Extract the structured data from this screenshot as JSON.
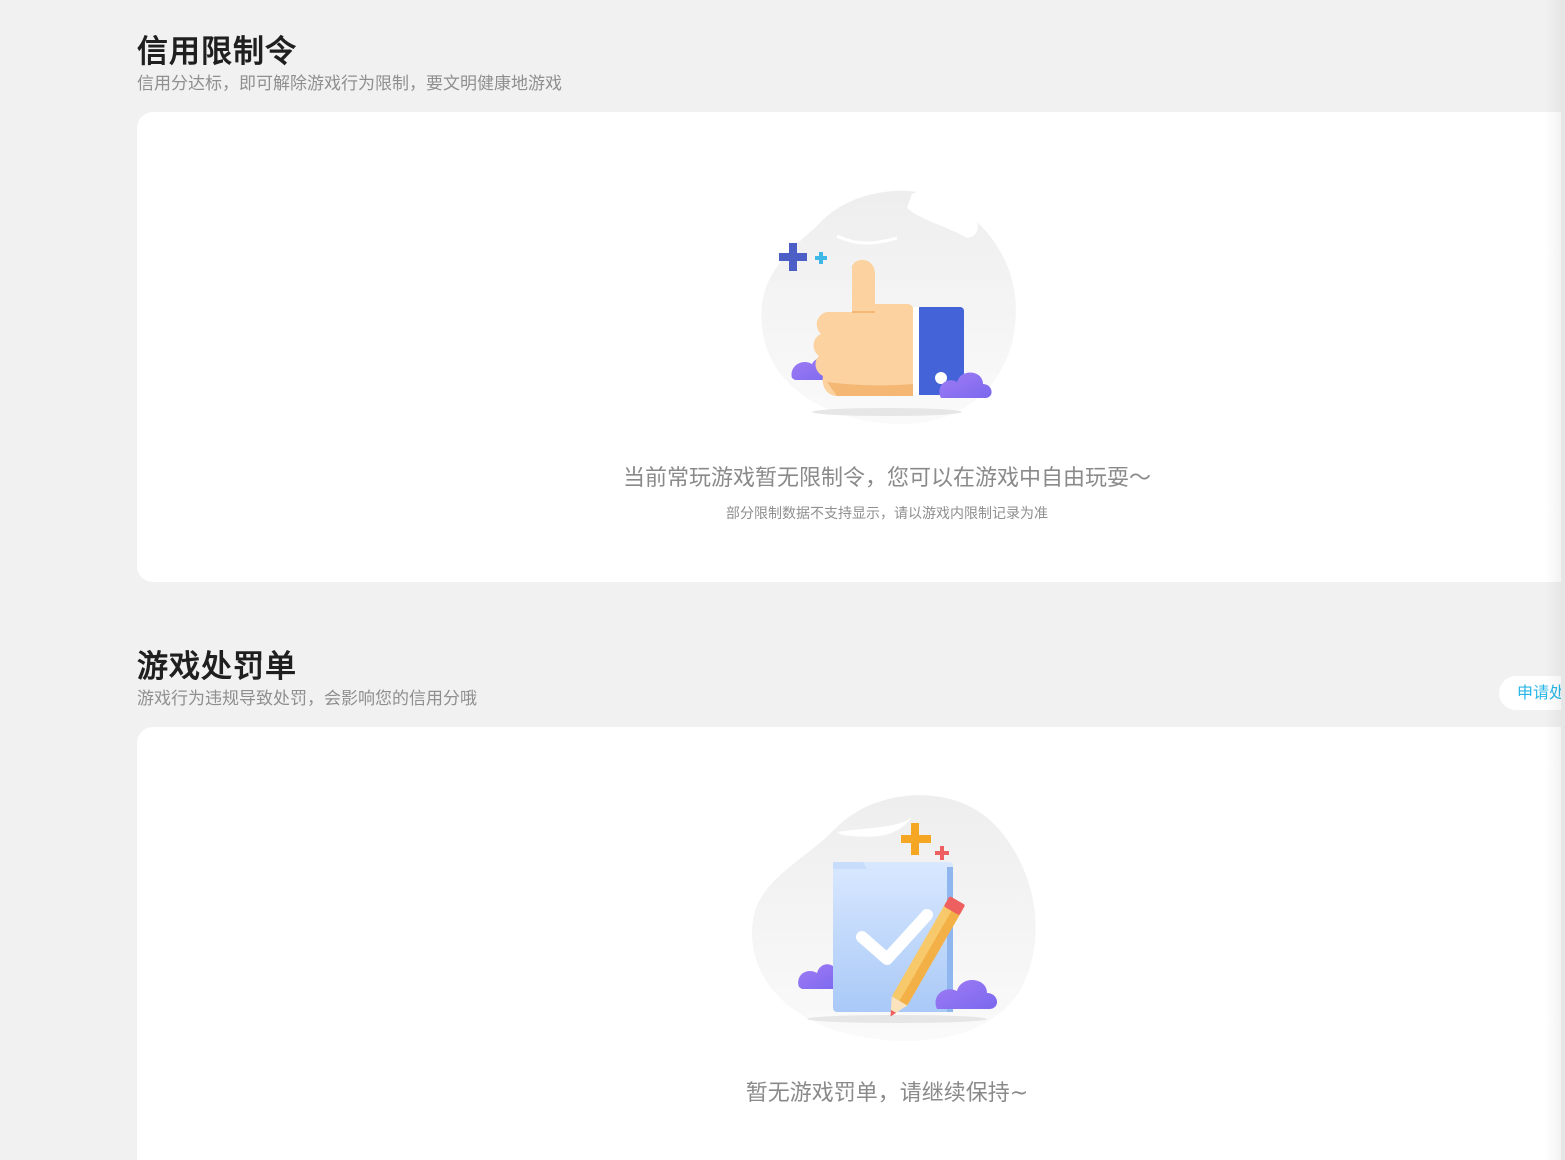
{
  "restriction": {
    "title": "信用限制令",
    "subtitle": "信用分达标，即可解除游戏行为限制，要文明健康地游戏",
    "empty_text": "当前常玩游戏暂无限制令，您可以在游戏中自由玩耍～",
    "note": "部分限制数据不支持显示，请以游戏内限制记录为准",
    "illustration_icon": "thumbs-up-icon"
  },
  "penalty": {
    "title": "游戏处罚单",
    "subtitle": "游戏行为违规导致处罚，会影响您的信用分哦",
    "appeal_button_label": "申请处",
    "empty_text": "暂无游戏罚单，请继续保持~",
    "illustration_icon": "document-check-pencil-icon"
  },
  "colors": {
    "background": "#f1f1f1",
    "card": "#ffffff",
    "title": "#1f1f1f",
    "muted_text": "#8f8f8f",
    "accent_link": "#29b6e6",
    "thumb_blue": "#4563d8",
    "cloud_purple": "#8b6cf0"
  }
}
